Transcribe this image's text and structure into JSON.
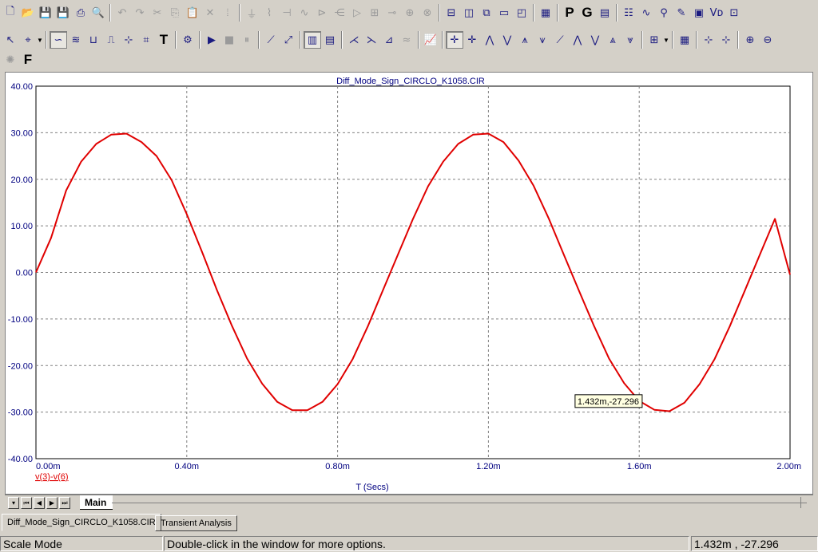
{
  "toolbar_top": {
    "items": [
      {
        "icon": "new-file-icon",
        "glyph": "🗋",
        "enabled": true
      },
      {
        "icon": "open-folder-icon",
        "glyph": "📂",
        "enabled": true
      },
      {
        "icon": "save-icon",
        "glyph": "💾",
        "enabled": true
      },
      {
        "icon": "save-all-icon",
        "glyph": "💾",
        "enabled": true
      },
      {
        "icon": "print-icon",
        "glyph": "⎙",
        "enabled": true
      },
      {
        "icon": "print-preview-icon",
        "glyph": "🔍",
        "enabled": true
      },
      {
        "sep": true
      },
      {
        "icon": "undo-icon",
        "glyph": "↶",
        "enabled": false
      },
      {
        "icon": "redo-icon",
        "glyph": "↷",
        "enabled": false
      },
      {
        "icon": "cut-icon",
        "glyph": "✂",
        "enabled": false
      },
      {
        "icon": "copy-icon",
        "glyph": "⎘",
        "enabled": false
      },
      {
        "icon": "paste-icon",
        "glyph": "📋",
        "enabled": false
      },
      {
        "icon": "delete-icon",
        "glyph": "✕",
        "enabled": false
      },
      {
        "icon": "select-all-icon",
        "glyph": "⦙",
        "enabled": false
      },
      {
        "sep": true
      },
      {
        "icon": "ground-icon",
        "glyph": "⏚",
        "enabled": false
      },
      {
        "icon": "resistor-icon",
        "glyph": "⌇",
        "enabled": false
      },
      {
        "icon": "capacitor-icon",
        "glyph": "⊣",
        "enabled": false
      },
      {
        "icon": "inductor-icon",
        "glyph": "∿",
        "enabled": false
      },
      {
        "icon": "diode-icon",
        "glyph": "⊳",
        "enabled": false
      },
      {
        "icon": "transistor-icon",
        "glyph": "⋲",
        "enabled": false
      },
      {
        "icon": "opamp-icon",
        "glyph": "▷",
        "enabled": false
      },
      {
        "icon": "battery-icon",
        "glyph": "⊞",
        "enabled": false
      },
      {
        "icon": "switch-icon",
        "glyph": "⊸",
        "enabled": false
      },
      {
        "icon": "source-icon",
        "glyph": "⊕",
        "enabled": false
      },
      {
        "icon": "current-source-icon",
        "glyph": "⊗",
        "enabled": false
      },
      {
        "sep": true
      },
      {
        "icon": "tile-horizontal-icon",
        "glyph": "⊟",
        "enabled": true
      },
      {
        "icon": "tile-vertical-icon",
        "glyph": "◫",
        "enabled": true
      },
      {
        "icon": "cascade-icon",
        "glyph": "⧉",
        "enabled": true
      },
      {
        "icon": "window-icon",
        "glyph": "▭",
        "enabled": true
      },
      {
        "icon": "split-window-icon",
        "glyph": "◰",
        "enabled": true
      },
      {
        "sep": true
      },
      {
        "icon": "calculator-icon",
        "glyph": "▦",
        "enabled": true
      },
      {
        "sep": true
      },
      {
        "icon": "p-icon",
        "glyph": "P",
        "enabled": true,
        "big": true
      },
      {
        "icon": "g-icon",
        "glyph": "G",
        "enabled": true,
        "big": true
      },
      {
        "icon": "window-list-icon",
        "glyph": "▤",
        "enabled": true
      },
      {
        "sep": true
      },
      {
        "icon": "component-list-icon",
        "glyph": "☷",
        "enabled": true
      },
      {
        "icon": "waveform-icon",
        "glyph": "∿",
        "enabled": true
      },
      {
        "icon": "probe-icon",
        "glyph": "⚲",
        "enabled": true
      },
      {
        "icon": "pencil-icon",
        "glyph": "✎",
        "enabled": true
      },
      {
        "icon": "frame-icon",
        "glyph": "▣",
        "enabled": true
      },
      {
        "icon": "vd-icon",
        "glyph": "Vᴅ",
        "enabled": true
      },
      {
        "icon": "zoom-window-icon",
        "glyph": "⊡",
        "enabled": true
      }
    ]
  },
  "toolbar_analysis": {
    "items": [
      {
        "icon": "select-arrow-icon",
        "glyph": "↖",
        "enabled": true
      },
      {
        "icon": "scale-mode-icon",
        "glyph": "⌖",
        "enabled": true,
        "dropdown": true
      },
      {
        "sep": true
      },
      {
        "icon": "waveform-select-icon",
        "glyph": "∽",
        "enabled": true,
        "pressed": true
      },
      {
        "icon": "multi-wave-icon",
        "glyph": "≋",
        "enabled": true
      },
      {
        "icon": "bracket-icon",
        "glyph": "⊔",
        "enabled": true
      },
      {
        "icon": "step-icon",
        "glyph": "⎍",
        "enabled": true
      },
      {
        "icon": "point-tag-icon",
        "glyph": "⊹",
        "enabled": true
      },
      {
        "icon": "label-icon",
        "glyph": "⌗",
        "enabled": true
      },
      {
        "icon": "text-icon",
        "glyph": "T",
        "enabled": true,
        "big": true
      },
      {
        "sep": true
      },
      {
        "icon": "properties-icon",
        "glyph": "⚙",
        "enabled": true
      },
      {
        "sep": true
      },
      {
        "icon": "run-icon",
        "glyph": "▶",
        "enabled": true
      },
      {
        "icon": "stop-icon",
        "glyph": "■",
        "enabled": false
      },
      {
        "icon": "pause-icon",
        "glyph": "⏸",
        "enabled": false
      },
      {
        "sep": true
      },
      {
        "icon": "line-tool-icon",
        "glyph": "⟋",
        "enabled": true
      },
      {
        "icon": "arrow-tool-icon",
        "glyph": "⤢",
        "enabled": true
      },
      {
        "sep": true
      },
      {
        "icon": "grid-on-icon",
        "glyph": "▥",
        "enabled": true,
        "pressed": true
      },
      {
        "icon": "grid-fine-icon",
        "glyph": "▤",
        "enabled": true
      },
      {
        "sep": true
      },
      {
        "icon": "cursor-peak-icon",
        "glyph": "⋌",
        "enabled": true
      },
      {
        "icon": "cursor-valley-icon",
        "glyph": "⋋",
        "enabled": true
      },
      {
        "icon": "cursor-slope-icon",
        "glyph": "⊿",
        "enabled": true
      },
      {
        "icon": "cursor-inflection-icon",
        "glyph": "≈",
        "enabled": false
      },
      {
        "sep": true
      },
      {
        "icon": "chart-icon",
        "glyph": "📈",
        "enabled": true
      },
      {
        "sep": true
      },
      {
        "icon": "cursor-left-icon",
        "glyph": "✛",
        "enabled": true,
        "pressed": true
      },
      {
        "icon": "cursor-right-icon",
        "glyph": "✛",
        "enabled": true
      },
      {
        "icon": "peak-icon",
        "glyph": "⋀",
        "enabled": true
      },
      {
        "icon": "valley-icon",
        "glyph": "⋁",
        "enabled": true
      },
      {
        "icon": "high-icon",
        "glyph": "⩚",
        "enabled": true
      },
      {
        "icon": "low-icon",
        "glyph": "⩛",
        "enabled": true
      },
      {
        "icon": "slope-icon",
        "glyph": "⟋",
        "enabled": true
      },
      {
        "icon": "peak-multi-icon",
        "glyph": "⋀",
        "enabled": true
      },
      {
        "icon": "valley-multi-icon",
        "glyph": "⋁",
        "enabled": true
      },
      {
        "icon": "next-peak-icon",
        "glyph": "⩓",
        "enabled": true
      },
      {
        "icon": "next-valley-icon",
        "glyph": "⩔",
        "enabled": true
      },
      {
        "sep": true
      },
      {
        "icon": "package-icon",
        "glyph": "⊞",
        "enabled": true,
        "dropdown": true
      },
      {
        "sep": true
      },
      {
        "icon": "table-icon",
        "glyph": "▦",
        "enabled": true
      },
      {
        "sep": true
      },
      {
        "icon": "tag-x-icon",
        "glyph": "⊹",
        "enabled": true
      },
      {
        "icon": "tag-y-icon",
        "glyph": "⊹",
        "enabled": true
      },
      {
        "sep": true
      },
      {
        "icon": "zoom-in-icon",
        "glyph": "⊕",
        "enabled": true
      },
      {
        "icon": "zoom-out-icon",
        "glyph": "⊖",
        "enabled": true
      }
    ]
  },
  "toolbar_third": {
    "items": [
      {
        "icon": "palette-icon",
        "glyph": "✺",
        "enabled": false
      },
      {
        "icon": "font-icon",
        "glyph": "F",
        "enabled": true,
        "big": true
      }
    ]
  },
  "plot": {
    "title": "Diff_Mode_Sign_CIRCLO_K1058.CIR",
    "xlabel": "T (Secs)",
    "trace_label": "v(3)-v(6)",
    "cursor_readout": "1.432m,-27.296",
    "trace_color": "#e00000",
    "axis_text_color": "#000080",
    "grid_color": "#808080"
  },
  "chart_data": {
    "type": "line",
    "title": "Diff_Mode_Sign_CIRCLO_K1058.CIR",
    "xlabel": "T (Secs)",
    "ylabel": "",
    "x_unit": "ms",
    "xlim": [
      0,
      2.0
    ],
    "ylim": [
      -40,
      40
    ],
    "x_ticks": [
      "0.00m",
      "0.40m",
      "0.80m",
      "1.20m",
      "1.60m",
      "2.00m"
    ],
    "y_ticks": [
      "40.00",
      "30.00",
      "20.00",
      "10.00",
      "0.00",
      "-10.00",
      "-20.00",
      "-30.00",
      "-40.00"
    ],
    "grid": true,
    "series": [
      {
        "name": "v(3)-v(6)",
        "color": "#e00000",
        "x": [
          0,
          0.04,
          0.08,
          0.12,
          0.16,
          0.2,
          0.24,
          0.28,
          0.32,
          0.36,
          0.4,
          0.44,
          0.48,
          0.52,
          0.56,
          0.6,
          0.64,
          0.68,
          0.72,
          0.76,
          0.8,
          0.84,
          0.88,
          0.92,
          0.96,
          1.0,
          1.04,
          1.08,
          1.12,
          1.16,
          1.2,
          1.24,
          1.28,
          1.32,
          1.36,
          1.4,
          1.44,
          1.48,
          1.52,
          1.56,
          1.6,
          1.64,
          1.68,
          1.72,
          1.76,
          1.8,
          1.84,
          1.88,
          1.92,
          1.96,
          2.0
        ],
        "y": [
          0,
          7.4,
          17.6,
          23.8,
          27.6,
          29.6,
          29.8,
          28.0,
          25.0,
          19.8,
          12.5,
          4.5,
          -3.8,
          -11.5,
          -18.5,
          -23.9,
          -27.8,
          -29.6,
          -29.6,
          -27.8,
          -24.0,
          -18.6,
          -11.6,
          -3.9,
          3.8,
          11.5,
          18.5,
          23.8,
          27.6,
          29.6,
          29.8,
          28.0,
          24.0,
          18.6,
          11.6,
          3.8,
          -3.9,
          -11.5,
          -18.5,
          -23.8,
          -27.6,
          -29.5,
          -29.8,
          -28.0,
          -24.0,
          -18.6,
          -11.6,
          -3.9,
          3.8,
          11.5,
          -0.5
        ]
      }
    ],
    "cursor": {
      "x": 1.432,
      "y": -27.296,
      "label": "1.432m,-27.296"
    }
  },
  "plot_tabs": {
    "sheet_label": "Main"
  },
  "doc_tabs": {
    "active": "Diff_Mode_Sign_CIRCLO_K1058.CIR",
    "inactive": "Transient Analysis"
  },
  "statusbar": {
    "mode": "Scale Mode",
    "hint": "Double-click in the window for more options.",
    "coords": "1.432m , -27.296"
  }
}
